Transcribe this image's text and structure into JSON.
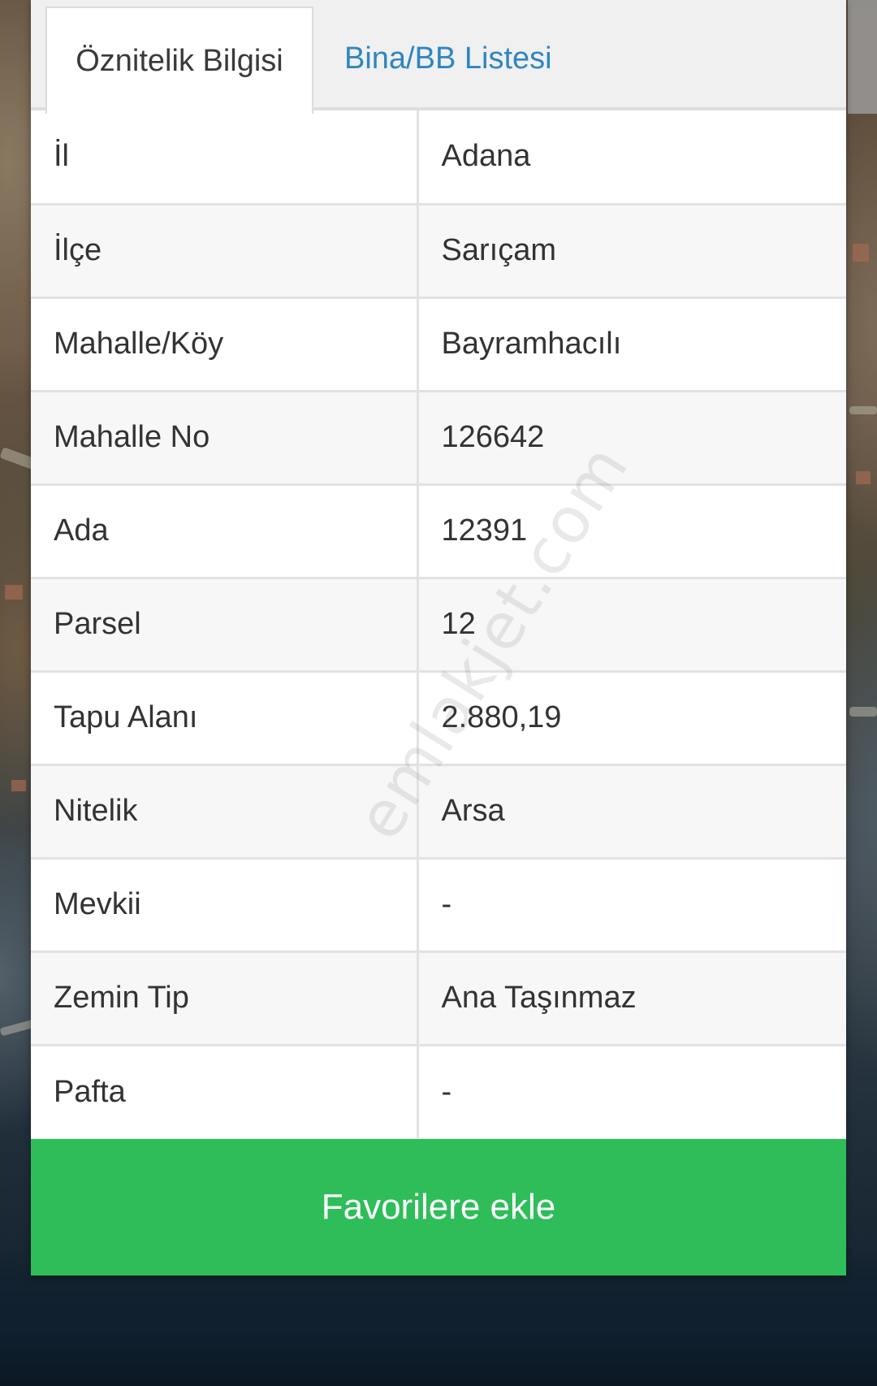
{
  "tabs": [
    {
      "label": "Öznitelik Bilgisi",
      "active": true
    },
    {
      "label": "Bina/BB Listesi",
      "active": false
    }
  ],
  "attributes": [
    {
      "label": "İl",
      "value": "Adana"
    },
    {
      "label": "İlçe",
      "value": "Sarıçam"
    },
    {
      "label": "Mahalle/Köy",
      "value": "Bayramhacılı"
    },
    {
      "label": "Mahalle No",
      "value": "126642"
    },
    {
      "label": "Ada",
      "value": "12391"
    },
    {
      "label": "Parsel",
      "value": "12"
    },
    {
      "label": "Tapu Alanı",
      "value": "2.880,19"
    },
    {
      "label": "Nitelik",
      "value": "Arsa"
    },
    {
      "label": "Mevkii",
      "value": "-"
    },
    {
      "label": "Zemin Tip",
      "value": "Ana Taşınmaz"
    },
    {
      "label": "Pafta",
      "value": "-"
    }
  ],
  "favorite_button_label": "Favorilere ekle",
  "watermark": "emlakjet.com",
  "colors": {
    "accent_green": "#2ebd59",
    "tab_link_blue": "#2e86c1"
  }
}
